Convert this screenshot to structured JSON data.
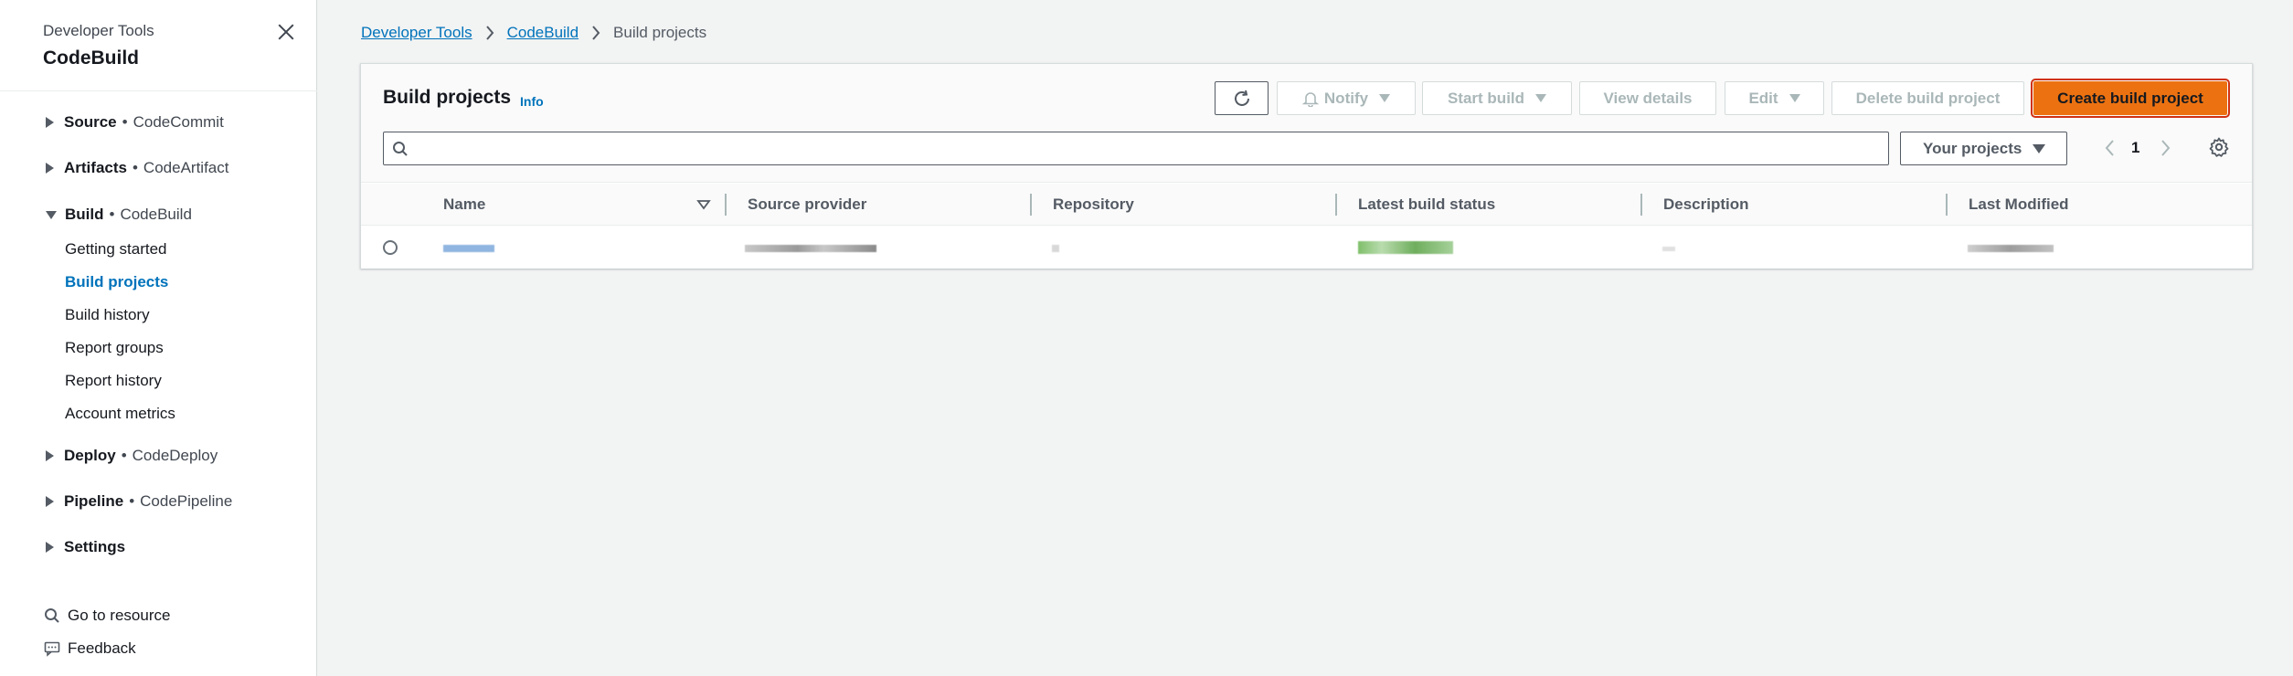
{
  "sidebar": {
    "super_title": "Developer Tools",
    "title": "CodeBuild",
    "sections": [
      {
        "label": "Source",
        "service": "CodeCommit"
      },
      {
        "label": "Artifacts",
        "service": "CodeArtifact"
      },
      {
        "label": "Build",
        "service": "CodeBuild"
      },
      {
        "label": "Deploy",
        "service": "CodeDeploy"
      },
      {
        "label": "Pipeline",
        "service": "CodePipeline"
      },
      {
        "label": "Settings",
        "service": ""
      }
    ],
    "separator": "•",
    "build_items": [
      {
        "label": "Getting started"
      },
      {
        "label": "Build projects"
      },
      {
        "label": "Build history"
      },
      {
        "label": "Report groups"
      },
      {
        "label": "Report history"
      },
      {
        "label": "Account metrics"
      }
    ],
    "footer": {
      "go_to_resource": "Go to resource",
      "feedback": "Feedback"
    }
  },
  "breadcrumb": {
    "items": [
      "Developer Tools",
      "CodeBuild"
    ],
    "current": "Build projects"
  },
  "panel": {
    "title": "Build projects",
    "info": "Info",
    "buttons": {
      "notify": "Notify",
      "start_build": "Start build",
      "view_details": "View details",
      "edit": "Edit",
      "delete": "Delete build project",
      "create": "Create build project"
    },
    "search_placeholder": "",
    "filter_select": "Your projects",
    "page": "1",
    "columns": [
      "Name",
      "Source provider",
      "Repository",
      "Latest build status",
      "Description",
      "Last Modified"
    ]
  },
  "colors": {
    "accent": "#0073bb",
    "primary_button": "#ec7211",
    "highlight_outline": "#d13212"
  },
  "icons": {
    "close": "close-icon",
    "refresh": "refresh-icon",
    "bell": "bell-icon",
    "search": "search-icon",
    "settings": "gear-icon"
  }
}
